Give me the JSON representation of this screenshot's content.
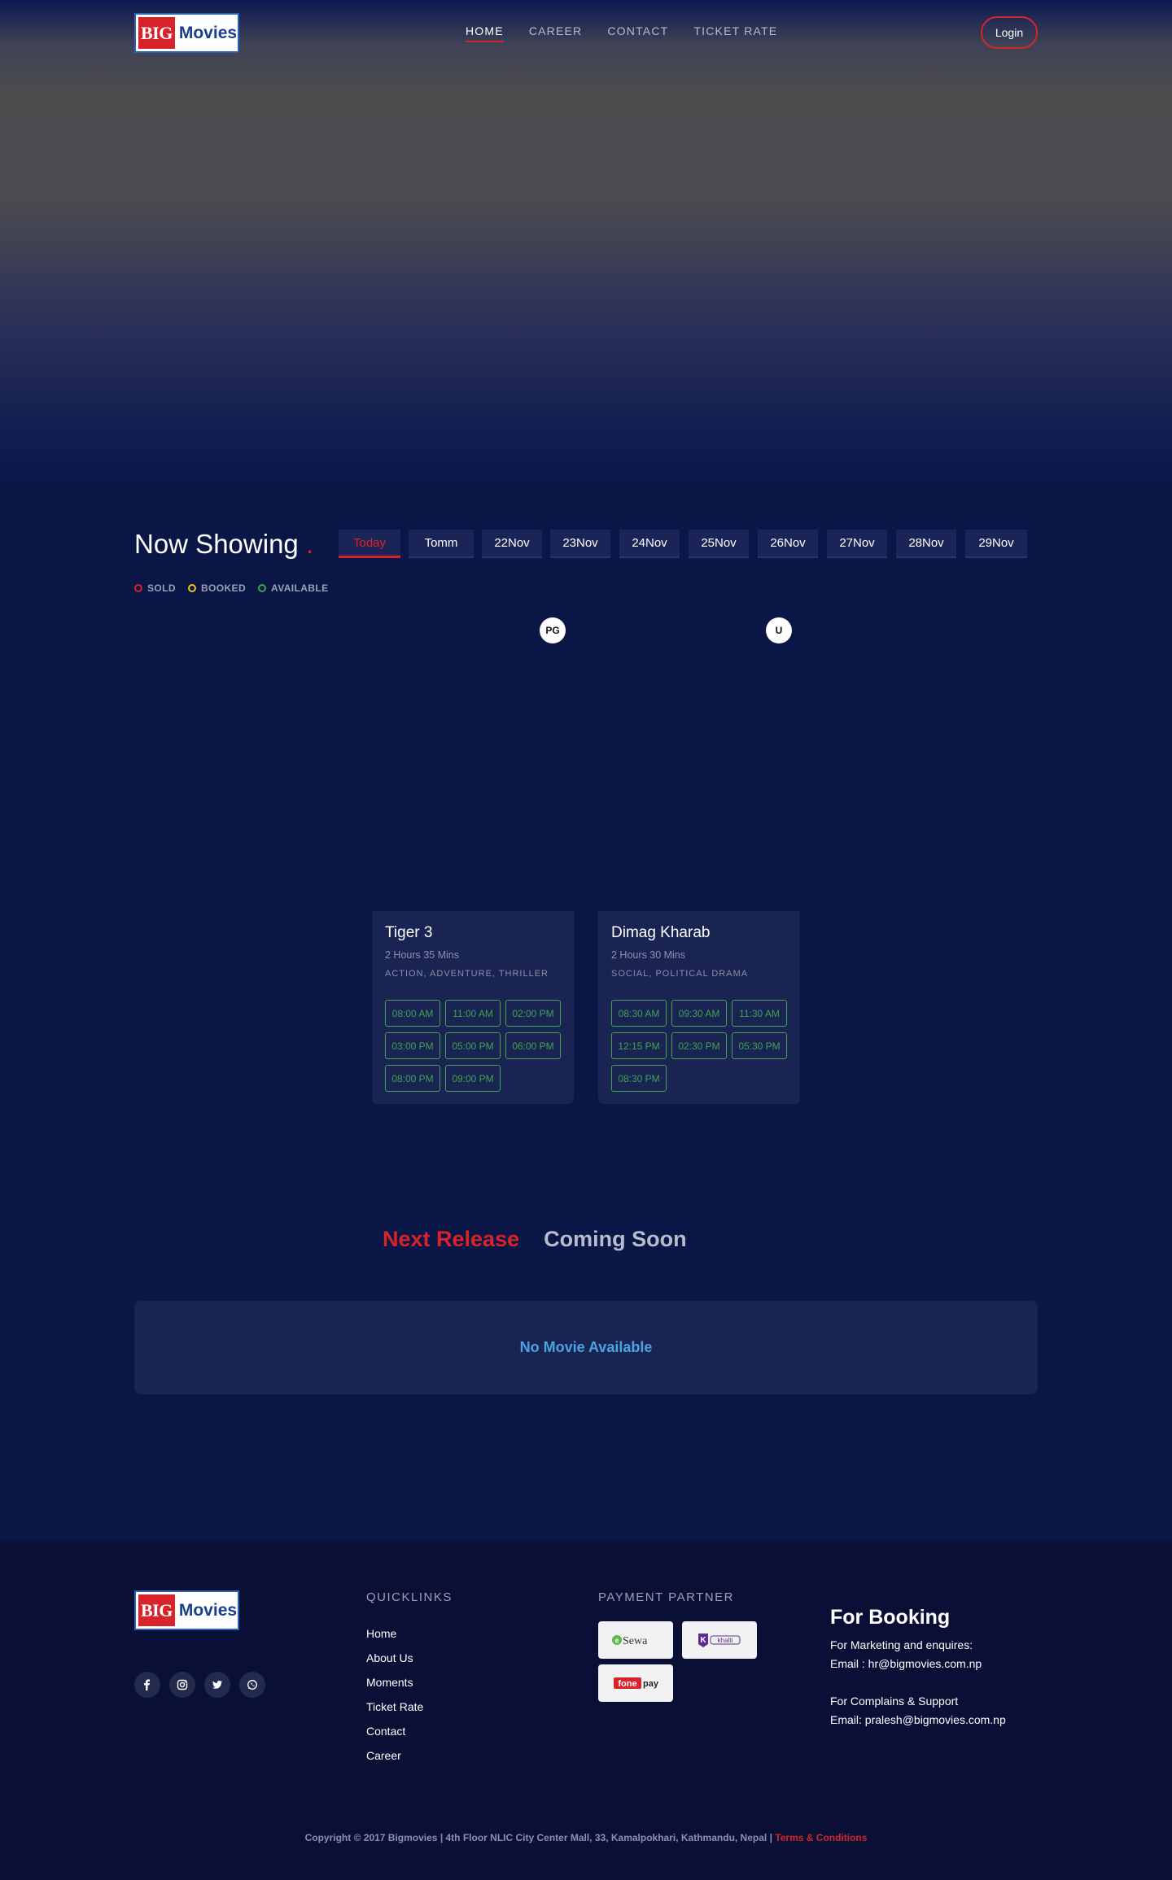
{
  "brand": {
    "logo_big": "BIG",
    "logo_movies": "Movies"
  },
  "nav": {
    "links": [
      {
        "label": "HOME",
        "active": true
      },
      {
        "label": "CAREER",
        "active": false
      },
      {
        "label": "CONTACT",
        "active": false
      },
      {
        "label": "TICKET RATE",
        "active": false
      }
    ],
    "login_label": "Login"
  },
  "now_showing": {
    "title": "Now Showing",
    "title_dot": ".",
    "dates": [
      "Today",
      "Tomm",
      "22Nov",
      "23Nov",
      "24Nov",
      "25Nov",
      "26Nov",
      "27Nov",
      "28Nov",
      "29Nov"
    ],
    "active_date": "Today",
    "legend": [
      {
        "label": "SOLD",
        "color": "#d8232a"
      },
      {
        "label": "BOOKED",
        "color": "#f0c419"
      },
      {
        "label": "AVAILABLE",
        "color": "#3fa34d"
      }
    ]
  },
  "movies": [
    {
      "rating": "PG",
      "title": "Tiger 3",
      "duration": "2 Hours 35 Mins",
      "genre": "ACTION, ADVENTURE, THRILLER",
      "showtimes": [
        "08:00 AM",
        "11:00 AM",
        "02:00 PM",
        "03:00 PM",
        "05:00 PM",
        "06:00 PM",
        "08:00 PM",
        "09:00 PM"
      ]
    },
    {
      "rating": "U",
      "title": "Dimag Kharab",
      "duration": "2 Hours 30 Mins",
      "genre": "SOCIAL, POLITICAL DRAMA",
      "showtimes": [
        "08:30 AM",
        "09:30 AM",
        "11:30 AM",
        "12:15 PM",
        "02:30 PM",
        "05:30 PM",
        "08:30 PM"
      ]
    }
  ],
  "releases": {
    "tabs": [
      {
        "label": "Next Release",
        "active": true
      },
      {
        "label": "Coming Soon",
        "active": false
      }
    ],
    "empty_message": "No Movie Available"
  },
  "footer": {
    "social_icons": [
      "facebook-icon",
      "instagram-icon",
      "twitter-icon",
      "whatsapp-icon"
    ],
    "quicklinks_title": "QUICKLINKS",
    "quicklinks": [
      "Home",
      "About Us",
      "Moments",
      "Ticket Rate",
      "Contact",
      "Career"
    ],
    "payment_title": "PAYMENT PARTNER",
    "payment_partners": [
      {
        "name": "eSewa"
      },
      {
        "name": "Khalti"
      },
      {
        "name": "fonepay"
      }
    ],
    "booking_title": "For Booking",
    "booking_lines": [
      "For Marketing and enquires:",
      "Email : hr@bigmovies.com.np",
      "For Complains & Support",
      "Email: pralesh@bigmovies.com.np"
    ],
    "copyright": "Copyright © 2017 Bigmovies | 4th Floor NLIC City Center Mall, 33, Kamalpokhari, Kathmandu, Nepal |",
    "terms_label": "Terms & Conditions"
  },
  "colors": {
    "background": "#0a1645",
    "accent_red": "#d8232a",
    "available_green": "#3fa34d",
    "card_bg": "#1a2453",
    "link_blue": "#4ba3e3"
  }
}
